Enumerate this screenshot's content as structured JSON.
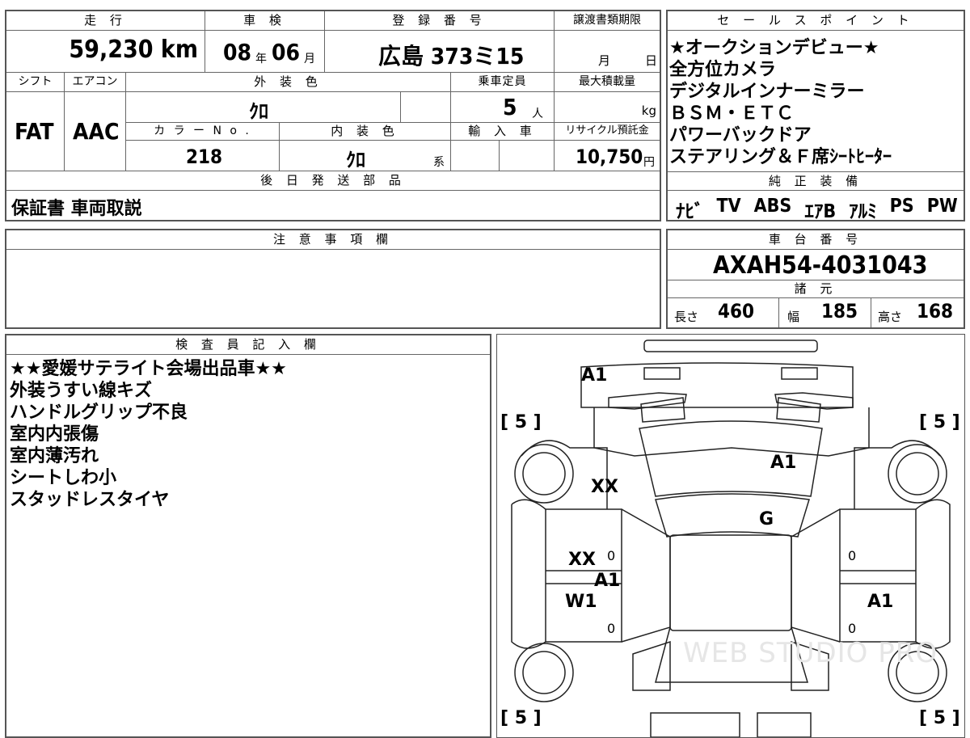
{
  "mileage": {
    "label": "走 行",
    "value": "59,230 km"
  },
  "inspection": {
    "label": "車 検",
    "year": "08",
    "year_unit": "年",
    "month": "06",
    "month_unit": "月"
  },
  "registration": {
    "label": "登 録 番 号",
    "value": "広島 373ミ15"
  },
  "transfer_deadline": {
    "label": "譲渡書類期限",
    "month_unit": "月",
    "day_unit": "日"
  },
  "shift": {
    "label": "シフト",
    "value": "FAT"
  },
  "aircon": {
    "label": "エアコン",
    "value": "AAC"
  },
  "exterior_color": {
    "label": "外 装 色",
    "value": "ｸﾛ"
  },
  "capacity": {
    "label": "乗車定員",
    "value": "5",
    "unit": "人"
  },
  "max_load": {
    "label": "最大積載量",
    "unit": "kg"
  },
  "color_no": {
    "label": "カ ラ ー N o .",
    "value": "218"
  },
  "interior_color": {
    "label": "内 装 色",
    "value": "ｸﾛ",
    "suffix": "系"
  },
  "import": {
    "label": "輸 入 車"
  },
  "recycle": {
    "label": "リサイクル預託金",
    "value": "10,750",
    "unit": "円"
  },
  "later_parts": {
    "label": "後 日 発 送 部 品",
    "value": "保証書 車両取説"
  },
  "sales_points": {
    "label": "セ ー ル ス ポ イ ン ト",
    "items": [
      "★オークションデビュー★",
      "全方位カメラ",
      "デジタルインナーミラー",
      "ＢＳＭ・ＥＴＣ",
      "パワーバックドア",
      "ステアリング＆Ｆ席ｼｰﾄﾋｰﾀｰ"
    ]
  },
  "genuine_equipment": {
    "label": "純 正 装 備",
    "items": [
      "ﾅﾋﾞ",
      "TV",
      "ABS",
      "ｴｱB",
      "ｱﾙﾐ",
      "PS",
      "PW"
    ]
  },
  "notes": {
    "label": "注 意 事 項 欄"
  },
  "chassis": {
    "label": "車 台 番 号",
    "value": "AXAH54-4031043"
  },
  "specs": {
    "label": "諸 元",
    "length_label": "長さ",
    "length": "460",
    "width_label": "幅",
    "width": "185",
    "height_label": "高さ",
    "height": "168"
  },
  "inspector": {
    "label": "検 査 員 記 入 欄",
    "items": [
      "★★愛媛サテライト会場出品車★★",
      "外装うすい線キズ",
      "ハンドルグリップ不良",
      "室内内張傷",
      "室内薄汚れ",
      "シートしわ小",
      "スタッドレスタイヤ"
    ]
  },
  "diagram": {
    "tire_marks": [
      "[ 5 ]",
      "[ 5 ]",
      "[ 5 ]",
      "[ 5 ]"
    ],
    "labels": [
      "A1",
      "A1",
      "XX",
      "G",
      "XX",
      "A1",
      "W1",
      "A1"
    ],
    "zeros": [
      "0",
      "0",
      "0",
      "0"
    ],
    "watermark": "WEB STUDIO PRO"
  }
}
